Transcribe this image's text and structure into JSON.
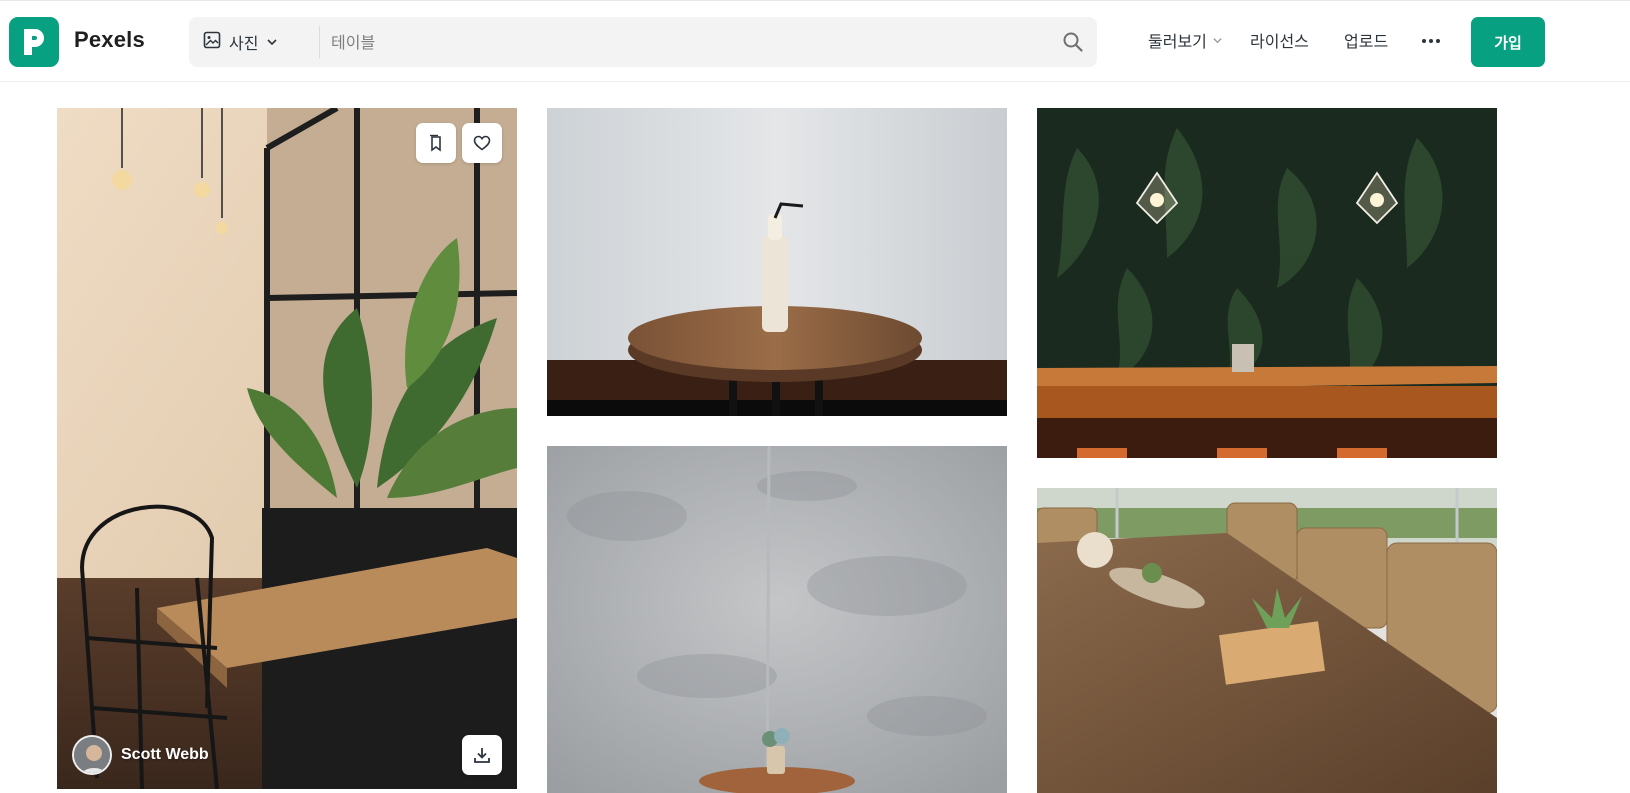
{
  "brand": {
    "name": "Pexels",
    "logo_icon": "pexels-logo-icon",
    "color": "#07a081"
  },
  "search": {
    "media_type": "사진",
    "media_icon": "image-icon",
    "query": "",
    "placeholder": "테이블",
    "submit_icon": "search-icon"
  },
  "nav": {
    "explore": "둘러보기",
    "license": "라이선스",
    "upload": "업로드",
    "more_icon": "more-horizontal-icon",
    "join": "가입"
  },
  "gallery": {
    "photos": [
      {
        "author": "Scott Webb",
        "hover": true,
        "actions": [
          "collect-icon",
          "heart-icon",
          "download-icon"
        ]
      },
      {
        "author": ""
      },
      {
        "author": ""
      },
      {
        "author": ""
      },
      {
        "author": ""
      }
    ]
  }
}
